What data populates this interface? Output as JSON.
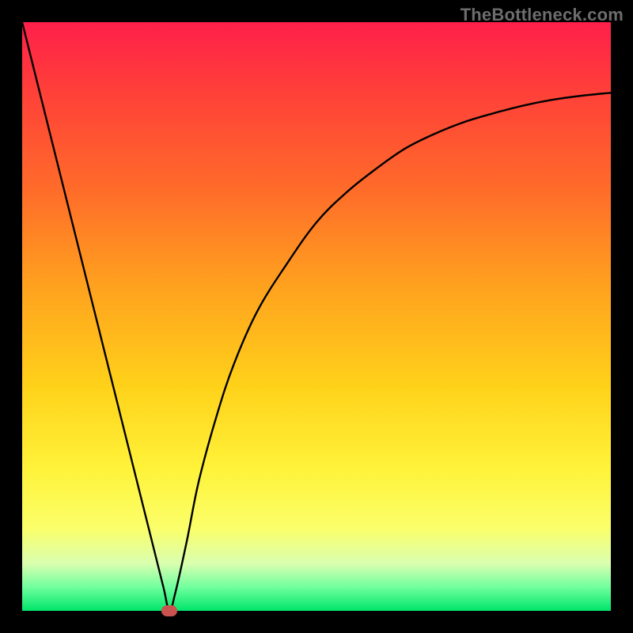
{
  "watermark": "TheBottleneck.com",
  "chart_data": {
    "type": "line",
    "title": "",
    "xlabel": "",
    "ylabel": "",
    "xlim": [
      0,
      100
    ],
    "ylim": [
      0,
      100
    ],
    "grid": false,
    "series": [
      {
        "name": "curve",
        "x": [
          0,
          5,
          10,
          15,
          20,
          22,
          24,
          25,
          26,
          28,
          30,
          33,
          36,
          40,
          45,
          50,
          55,
          60,
          65,
          70,
          75,
          80,
          85,
          90,
          95,
          100
        ],
        "y": [
          100,
          80,
          60,
          40,
          20,
          12,
          4,
          0,
          3,
          12,
          22,
          33,
          42,
          51,
          59,
          66,
          71,
          75,
          78.5,
          81,
          83,
          84.5,
          85.8,
          86.8,
          87.5,
          88
        ]
      }
    ],
    "marker": {
      "x": 25,
      "y": 0
    },
    "background_gradient": {
      "stops": [
        {
          "pos": 0,
          "color": "#ff1f4a"
        },
        {
          "pos": 10,
          "color": "#ff3b3b"
        },
        {
          "pos": 28,
          "color": "#ff6a2a"
        },
        {
          "pos": 45,
          "color": "#ffa21e"
        },
        {
          "pos": 62,
          "color": "#ffd21a"
        },
        {
          "pos": 76,
          "color": "#fff33a"
        },
        {
          "pos": 86,
          "color": "#fbff6a"
        },
        {
          "pos": 92,
          "color": "#d9ffb0"
        },
        {
          "pos": 96,
          "color": "#6fff9e"
        },
        {
          "pos": 100,
          "color": "#00e56a"
        }
      ]
    }
  }
}
